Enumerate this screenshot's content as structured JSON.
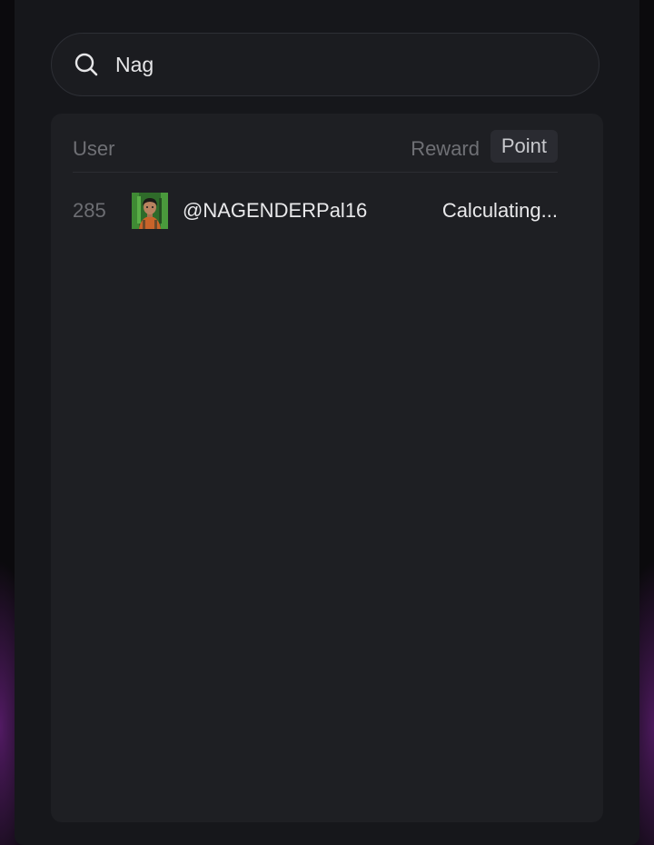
{
  "search": {
    "value": "Nag",
    "icon": "search-icon"
  },
  "leaderboard": {
    "columns": {
      "user": "User",
      "reward": "Reward",
      "point": "Point"
    },
    "active_column": "Point",
    "rows": [
      {
        "rank": "285",
        "avatar": "user-avatar",
        "handle": "@NAGENDERPal16",
        "value": "Calculating..."
      }
    ]
  },
  "colors": {
    "panel": "#16171b",
    "board": "#1e1f23",
    "text_primary": "#e9e9eb",
    "text_muted": "#6f7075",
    "accent_glow": "#8c28aa"
  }
}
